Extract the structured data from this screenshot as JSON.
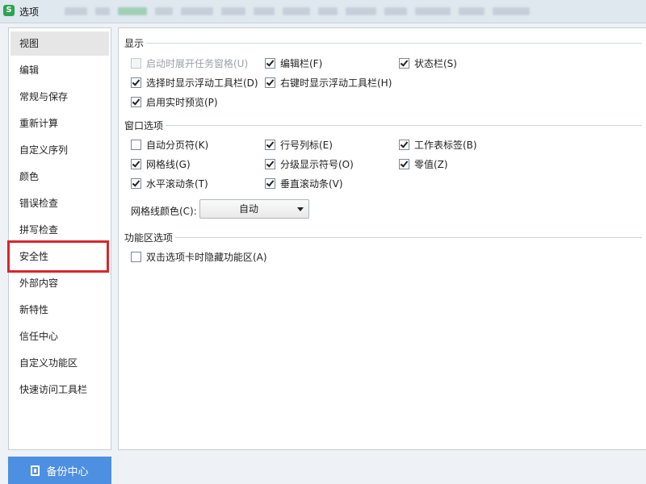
{
  "window": {
    "logo": "S",
    "title": "选项"
  },
  "sidebar": {
    "items": [
      {
        "label": "视图",
        "selected": true
      },
      {
        "label": "编辑"
      },
      {
        "label": "常规与保存"
      },
      {
        "label": "重新计算"
      },
      {
        "label": "自定义序列"
      },
      {
        "label": "颜色"
      },
      {
        "label": "错误检查"
      },
      {
        "label": "拼写检查"
      },
      {
        "label": "安全性",
        "highlighted": true
      },
      {
        "label": "外部内容"
      },
      {
        "label": "新特性"
      },
      {
        "label": "信任中心"
      },
      {
        "label": "自定义功能区"
      },
      {
        "label": "快速访问工具栏"
      }
    ],
    "backup_label": "备份中心"
  },
  "display": {
    "title": "显示",
    "options": [
      {
        "label": "启动时展开任务窗格(U)",
        "checked": false,
        "disabled": true
      },
      {
        "label": "编辑栏(F)",
        "checked": true
      },
      {
        "label": "状态栏(S)",
        "checked": true
      },
      {
        "label": "选择时显示浮动工具栏(D)",
        "checked": true
      },
      {
        "label": "右键时显示浮动工具栏(H)",
        "checked": true
      },
      {
        "label": "启用实时预览(P)",
        "checked": true
      }
    ]
  },
  "window_options": {
    "title": "窗口选项",
    "options": [
      {
        "label": "自动分页符(K)",
        "checked": false
      },
      {
        "label": "行号列标(E)",
        "checked": true
      },
      {
        "label": "工作表标签(B)",
        "checked": true
      },
      {
        "label": "网格线(G)",
        "checked": true
      },
      {
        "label": "分级显示符号(O)",
        "checked": true
      },
      {
        "label": "零值(Z)",
        "checked": true
      },
      {
        "label": "水平滚动条(T)",
        "checked": true
      },
      {
        "label": "垂直滚动条(V)",
        "checked": true
      }
    ],
    "grid_color_label": "网格线颜色(C):",
    "grid_color_value": "自动"
  },
  "ribbon": {
    "title": "功能区选项",
    "options": [
      {
        "label": "双击选项卡时隐藏功能区(A)",
        "checked": false
      }
    ]
  },
  "colors": {
    "accent": "#4d8fe0",
    "highlight": "#d9262a",
    "brand": "#2ea34f"
  }
}
